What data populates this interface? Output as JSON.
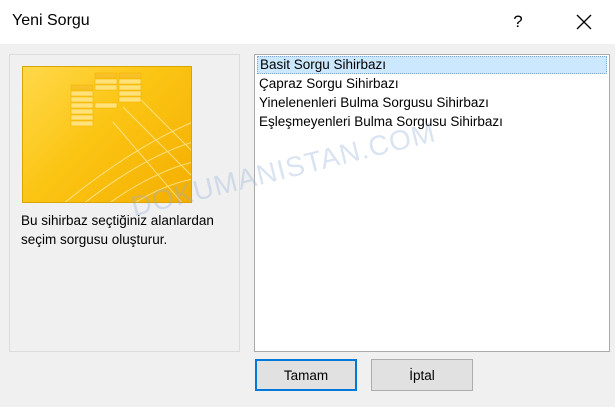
{
  "window": {
    "title": "Yeni Sorgu",
    "help_label": "?"
  },
  "left_panel": {
    "description": "Bu sihirbaz seçtiğiniz alanlardan seçim sorgusu oluşturur."
  },
  "wizard_list": {
    "selected_index": 0,
    "items": [
      {
        "label": "Basit Sorgu Sihirbazı"
      },
      {
        "label": "Çapraz Sorgu Sihirbazı"
      },
      {
        "label": "Yinelenenleri Bulma Sorgusu Sihirbazı"
      },
      {
        "label": "Eşleşmeyenleri Bulma Sorgusu Sihirbazı"
      }
    ]
  },
  "buttons": {
    "ok_label": "Tamam",
    "cancel_label": "İptal"
  },
  "watermark": {
    "text": "DOKUMANISTAN.COM"
  },
  "colors": {
    "accent": "#0078d7",
    "selection": "#cce8ff",
    "illustration": "#fbc514"
  }
}
